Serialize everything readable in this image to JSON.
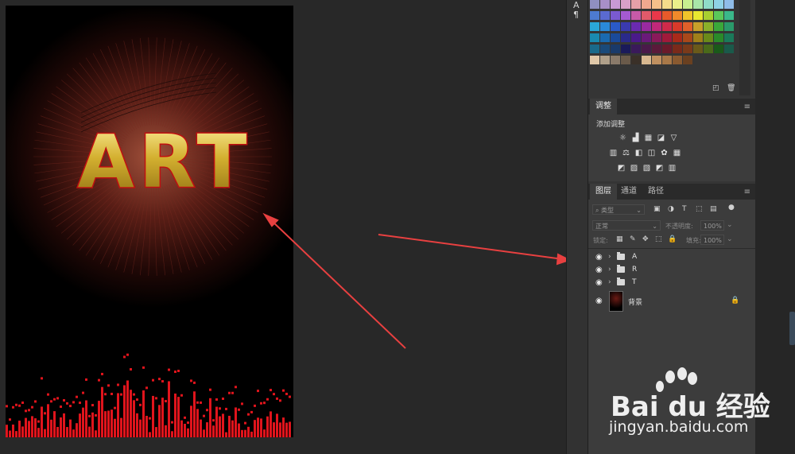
{
  "canvas": {
    "title_text": "ART",
    "title_color": "#e3c04a",
    "glow_color": "#8a2a1e",
    "eq_color": "#e0141c"
  },
  "swatch_colors": [
    [
      "#8f8fc0",
      "#a88fc8",
      "#c89ad6",
      "#d9a0c8",
      "#e6a0a8",
      "#f0a88f",
      "#f5c08a",
      "#f5dc8a",
      "#eaf08a",
      "#c8f08f",
      "#a8e6a8",
      "#8fdcc8",
      "#8fd2e6",
      "#8fbce8"
    ],
    [
      "#4d7bd0",
      "#5a6ad0",
      "#7a5ad0",
      "#a45ad0",
      "#c85aa8",
      "#e05a6a",
      "#e8384a",
      "#e85a2a",
      "#f08a2a",
      "#f0c42a",
      "#e8e830",
      "#a8d030",
      "#5ac85a",
      "#3ab88a"
    ],
    [
      "#2aa8d8",
      "#2a8ad8",
      "#2a5ac8",
      "#3a3ab0",
      "#6a2ab0",
      "#9a2aa0",
      "#c0287a",
      "#d02a4a",
      "#d83a2a",
      "#e0602a",
      "#c8a02a",
      "#8ab02a",
      "#3aa83a",
      "#2a9a6a"
    ],
    [
      "#1a8ab0",
      "#1a6ab0",
      "#1a4a9a",
      "#2a2a8a",
      "#4a1a8a",
      "#6a1a7a",
      "#8a1a5a",
      "#a01a3a",
      "#a82a1a",
      "#a8481a",
      "#a0801a",
      "#6a8a1a",
      "#2a8a2a",
      "#1a7a5a"
    ],
    [
      "#1a6a8a",
      "#1a4a7a",
      "#1a3a6a",
      "#1a1a5a",
      "#3a1a5a",
      "#4a1a4a",
      "#5a1a3a",
      "#6a1a2a",
      "#7a2a1a",
      "#7a3a1a",
      "#6a5a1a",
      "#4a6a1a",
      "#1a5a1a",
      "#1a5a4a"
    ],
    [
      "#e0c8a8",
      "#b0a08a",
      "#8a7a6a",
      "#6a5a4a",
      "#3a3028",
      "#d8b890",
      "#c09060",
      "#a87848",
      "#8a5a30",
      "#6a4020"
    ]
  ],
  "panels": {
    "adjustments": {
      "tab_label": "调整",
      "title": "添加调整",
      "icon_rows": [
        [
          "brightness-icon",
          "levels-icon",
          "curves-icon",
          "exposure-icon",
          "vibrance-icon"
        ],
        [
          "hue-icon",
          "balance-icon",
          "bw-icon",
          "photo-filter-icon",
          "mixer-icon",
          "lookup-icon"
        ],
        [
          "invert-icon",
          "posterize-icon",
          "threshold-icon",
          "selective-color-icon",
          "gradient-map-icon"
        ]
      ]
    },
    "layers": {
      "tabs": [
        "图层",
        "通道",
        "路径"
      ],
      "filter_label": "类型",
      "blend_mode": "正常",
      "opacity_label": "不透明度:",
      "opacity_value": "100%",
      "lock_label": "锁定:",
      "fill_label": "填充:",
      "fill_value": "100%",
      "layers": [
        {
          "name": "A",
          "type": "folder"
        },
        {
          "name": "R",
          "type": "folder"
        },
        {
          "name": "T",
          "type": "folder"
        },
        {
          "name": "背景",
          "type": "image"
        }
      ]
    }
  },
  "watermark": {
    "brand": "Bai du 经验",
    "url": "jingyan.baidu.com"
  },
  "annotation_color": "#e84040"
}
